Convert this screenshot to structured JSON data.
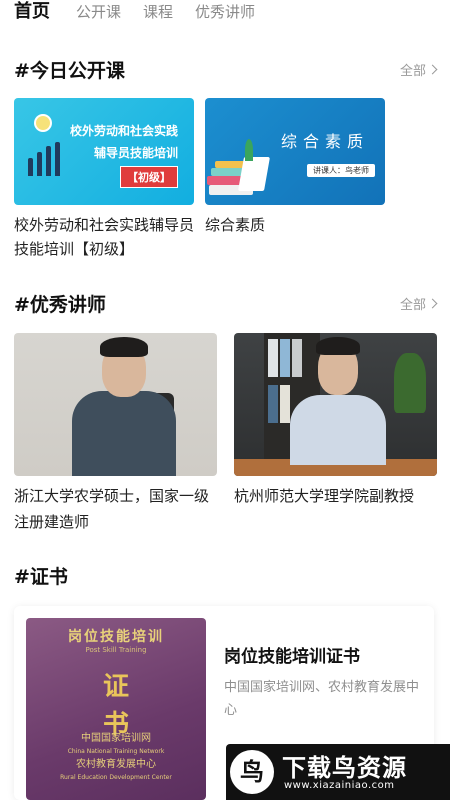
{
  "tabs": [
    {
      "label": "首页",
      "active": true
    },
    {
      "label": "公开课",
      "active": false
    },
    {
      "label": "课程",
      "active": false
    },
    {
      "label": "优秀讲师",
      "active": false
    }
  ],
  "today_courses": {
    "title": "#今日公开课",
    "more_label": "全部",
    "items": [
      {
        "name": "校外劳动和社会实践辅导员技能培训【初级】",
        "thumb_title_line1": "校外劳动和社会实践",
        "thumb_title_line2": "辅导员技能培训",
        "thumb_badge": "【初级】"
      },
      {
        "name": "综合素质",
        "thumb_title": "综合素质",
        "thumb_teacher": "讲课人：鸟老师"
      }
    ]
  },
  "teachers": {
    "title": "#优秀讲师",
    "more_label": "全部",
    "items": [
      {
        "desc": "浙江大学农学硕士，国家一级注册建造师"
      },
      {
        "desc": "杭州师范大学理学院副教授"
      }
    ]
  },
  "certificates": {
    "title": "#证书",
    "items": [
      {
        "title": "岗位技能培训证书",
        "issuer": "中国国家培训网、农村教育发展中心",
        "img_header": "岗位技能培训",
        "img_subheader": "Post Skill Training",
        "img_char1": "证",
        "img_char2": "书",
        "img_org1": "中国国家培训网",
        "img_org1_en": "China National Training Network",
        "img_org2": "农村教育发展中心",
        "img_org2_en": "Rural Education Development Center"
      }
    ]
  },
  "watermark": {
    "logo": "鸟",
    "name": "下载鸟资源",
    "url": "www.xiazainiao.com"
  },
  "colors": {
    "accent_text": "#111111",
    "muted_text": "#8a8a8a",
    "thumb1_bg": "#1fb5e3",
    "thumb2_bg": "#1a84c6",
    "badge_red": "#e03c3c",
    "cert_purple": "#6f3f6f"
  }
}
